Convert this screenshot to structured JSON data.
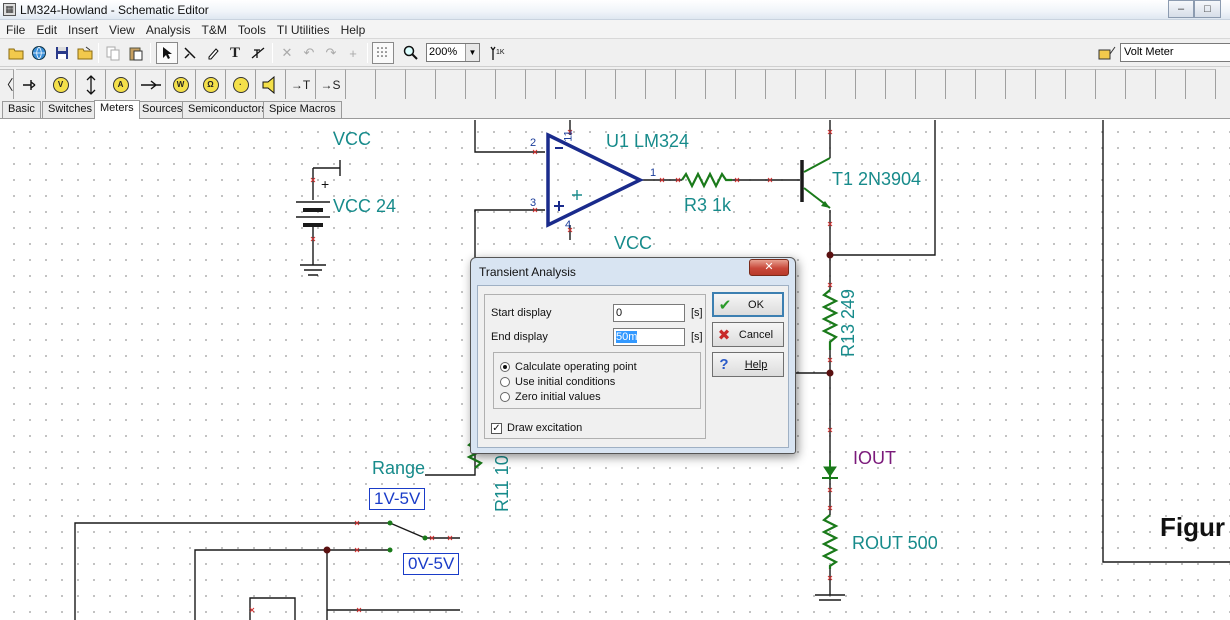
{
  "window": {
    "title": "LM324-Howland - Schematic Editor",
    "app_icon": "tina-app-icon",
    "controls": {
      "minimize": "–",
      "maximize": "□",
      "close": "✕"
    }
  },
  "menu": [
    "File",
    "Edit",
    "Insert",
    "View",
    "Analysis",
    "T&M",
    "Tools",
    "TI Utilities",
    "Help"
  ],
  "toolbar": {
    "zoom": "200%",
    "meter_selector": "Volt Meter"
  },
  "component_tabs": [
    "Basic",
    "Switches",
    "Meters",
    "Sources",
    "Semiconductors",
    "Spice Macros"
  ],
  "active_tab": "Meters",
  "component_toolbar": {
    "ammeter_glyph": "A",
    "wattmeter_glyph": "W",
    "voltage_pin_glyph": "→T",
    "current_pin_glyph": "→S"
  },
  "schematic": {
    "labels": {
      "vcc_top": "VCC",
      "vcc_source": "VCC 24",
      "plus_sign": "+",
      "opamp": "U1 LM324",
      "r3": "R3 1k",
      "transistor": "T1 2N3904",
      "vcc_mid": "VCC",
      "r13": "R13 249",
      "iout": "IOUT",
      "rout": "ROUT 500",
      "range": "Range",
      "r11": "R11 10",
      "range_opt1": "1V-5V",
      "range_opt2": "0V-5V",
      "figure": "Figur"
    },
    "pins": {
      "p2": "2",
      "p3": "3",
      "p11": "11",
      "p4": "4",
      "p1": "1"
    }
  },
  "dialog": {
    "title": "Transient Analysis",
    "close_glyph": "✕",
    "start_label": "Start display",
    "start_value": "0",
    "start_unit": "[s]",
    "end_label": "End display",
    "end_value": "50m",
    "end_unit": "[s]",
    "radio_options": [
      "Calculate operating point",
      "Use initial conditions",
      "Zero initial values"
    ],
    "selected_radio": 0,
    "checkbox_label": "Draw excitation",
    "checkbox_checked": true,
    "buttons": {
      "ok": "OK",
      "cancel": "Cancel",
      "help": "Help"
    }
  }
}
